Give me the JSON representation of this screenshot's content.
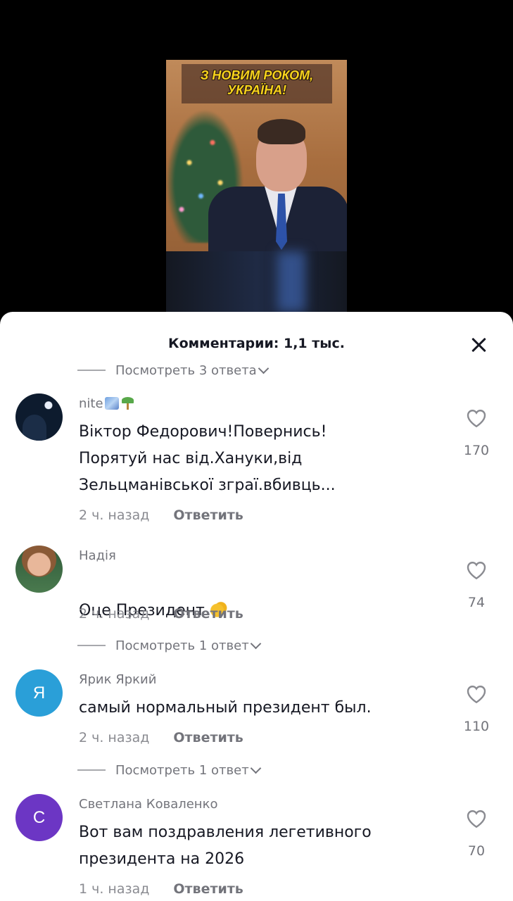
{
  "video": {
    "banner_line1": "З НОВИМ РОКОМ,",
    "banner_line2": "УКРАЇНА!"
  },
  "comments_panel": {
    "title": "Комментарии: 1,1 тыс.",
    "top_replies_label": "Посмотреть 3 ответа",
    "comments": [
      {
        "username": "nite",
        "badges": [
          "sparkle-emoji",
          "palm-tree-emoji"
        ],
        "avatar": "night-sky-photo",
        "text": "Віктор Федорович!Повернись!\nПорятуй нас від.Хануки,від\nЗельцманівської зграї.вбивць...",
        "time": "2 ч. назад",
        "reply_label": "Ответить",
        "likes": "170"
      },
      {
        "username": "Надія",
        "avatar": "woman-photo",
        "text": "Оце Президент",
        "emoji": "clapping-hands",
        "time": "2 ч. назад",
        "reply_label": "Ответить",
        "likes": "74",
        "replies_label": "Посмотреть 1 ответ"
      },
      {
        "username": "Ярик Яркий",
        "avatar_letter": "Я",
        "avatar_color": "#2a9fd8",
        "text": "самый нормальный президент был.",
        "time": "2 ч. назад",
        "reply_label": "Ответить",
        "likes": "110",
        "replies_label": "Посмотреть 1 ответ"
      },
      {
        "username": "Светлана Коваленко",
        "avatar_letter": "С",
        "avatar_color": "#6c36c4",
        "text": "Вот вам поздравления легетивного\nпрезидента на 2026",
        "time": "1 ч. назад",
        "reply_label": "Ответить",
        "likes": "70"
      }
    ]
  }
}
